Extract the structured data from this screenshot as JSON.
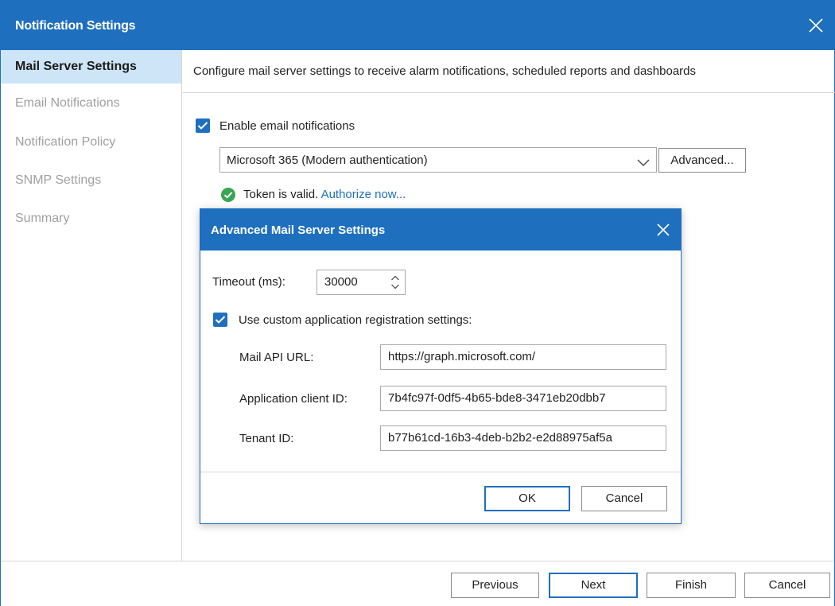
{
  "window": {
    "title": "Notification Settings"
  },
  "sidebar": {
    "items": [
      {
        "label": "Mail Server Settings",
        "active": true
      },
      {
        "label": "Email Notifications",
        "active": false
      },
      {
        "label": "Notification Policy",
        "active": false
      },
      {
        "label": "SNMP Settings",
        "active": false
      },
      {
        "label": "Summary",
        "active": false
      }
    ]
  },
  "main": {
    "description": "Configure mail server settings to receive alarm notifications, scheduled reports and dashboards",
    "enable_email": {
      "label": "Enable email notifications",
      "checked": true
    },
    "provider": {
      "value": "Microsoft 365 (Modern authentication)"
    },
    "advanced_label": "Advanced...",
    "token": {
      "status": "Token is valid.",
      "link": "Authorize now..."
    }
  },
  "modal": {
    "title": "Advanced Mail Server Settings",
    "timeout": {
      "label": "Timeout (ms):",
      "value": "30000"
    },
    "custom_registration": {
      "label": "Use custom application registration settings:",
      "checked": true
    },
    "mail_api_url": {
      "label": "Mail API URL:",
      "value": "https://graph.microsoft.com/"
    },
    "client_id": {
      "label": "Application client ID:",
      "value": "7b4fc97f-0df5-4b65-bde8-3471eb20dbb7"
    },
    "tenant_id": {
      "label": "Tenant ID:",
      "value": "b77b61cd-16b3-4deb-b2b2-e2d88975af5a"
    },
    "ok_label": "OK",
    "cancel_label": "Cancel"
  },
  "footer": {
    "previous_label": "Previous",
    "next_label": "Next",
    "finish_label": "Finish",
    "cancel_label": "Cancel"
  },
  "colors": {
    "accent": "#1f6fbf",
    "selected_nav": "#cde5f7",
    "success": "#3aa655",
    "disabled_text": "#a0a0a0"
  },
  "icons": {
    "close": "close-icon",
    "checkmark": "checkmark-icon",
    "chevron": "chevron-down-icon",
    "success": "check-circle-icon",
    "spinner": "spinner-arrows-icon"
  }
}
